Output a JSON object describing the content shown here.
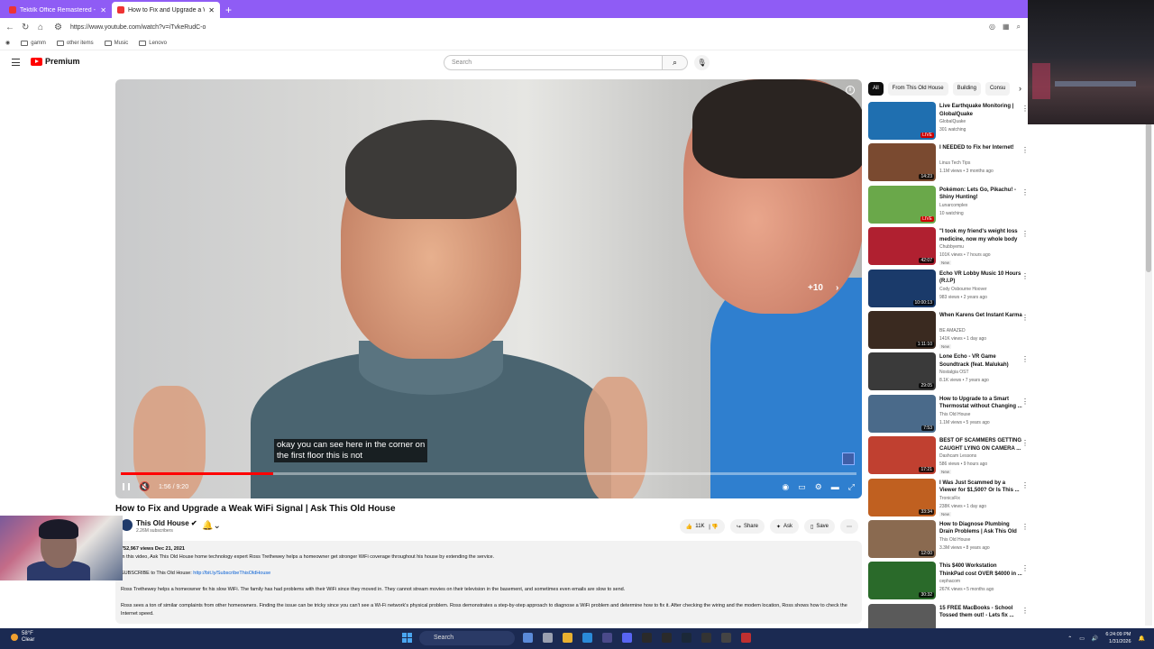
{
  "browser": {
    "tabs": [
      {
        "title": "Tektilk Office Remastered - Rob...",
        "active": false
      },
      {
        "title": "How to Fix and Upgrade a Weak W...",
        "active": true
      }
    ],
    "url": "https://www.youtube.com/watch?v=iTvkeRudC-o",
    "bookmarks": [
      "gamm",
      "other items",
      "Music",
      "Lenovo"
    ]
  },
  "yt": {
    "logo": "Premium",
    "search_placeholder": "Search"
  },
  "player": {
    "caption_line1": "okay you can see here in the corner on",
    "caption_line2": "the first floor this is not",
    "skip": "+10",
    "time": "1:56 / 9:20",
    "progress_fraction": 0.207
  },
  "video": {
    "title": "How to Fix and Upgrade a Weak WiFi Signal | Ask This Old House",
    "channel": "This Old House",
    "subs": "2.26M subscribers",
    "likes": "11K",
    "share": "Share",
    "ask": "Ask",
    "save": "Save"
  },
  "description": {
    "stats": "752,967 views  Dec 21, 2021",
    "line1": "In this video, Ask This Old House home technology expert Ross Trethewey helps a homeowner get stronger WiFi coverage throughout his house by extending the service.",
    "subscribe_label": "SUBSCRIBE to This Old House: ",
    "subscribe_link": "http://bit.ly/SubscribeThisOldHouse",
    "line2": "Ross Trethewey helps a homeowner fix his slow WiFi. The family has had problems with their WiFi since they moved in. They cannot stream movies on their television in the basement, and sometimes even emails are slow to send.",
    "line3": "Ross sees a ton of similar complaints from other homeowners. Finding the issue can be tricky since you can't see a Wi-Fi network's physical problem. Ross demonstrates a step-by-step approach to diagnose a WiFi problem and determine how to fix it. After checking the wiring and the modem location, Ross shows how to check the Internet speed."
  },
  "chips": [
    "All",
    "From This Old House",
    "Building",
    "Consu"
  ],
  "recommendations": [
    {
      "title": "Live Earthquake Monitoring | GlobalQuake",
      "channel": "GlobalQuake",
      "meta": "301 watching",
      "duration": "LIVE",
      "live": true,
      "badge": "",
      "color": "#1f6fb0"
    },
    {
      "title": "I NEEDED to Fix her Internet!",
      "channel": "Linus Tech Tips",
      "meta": "1.1M views • 3 months ago",
      "duration": "14:23",
      "live": false,
      "badge": "",
      "color": "#7a4a30"
    },
    {
      "title": "Pokémon: Lets Go, Pikachu! - Shiny Hunting!",
      "channel": "Lunarcomplex",
      "meta": "10 watching",
      "duration": "LIVE",
      "live": true,
      "badge": "",
      "color": "#6aa84a"
    },
    {
      "title": "\"I took my friend's weight loss medicine, now my whole body ...",
      "channel": "Chubbyemu",
      "meta": "101K views • 7 hours ago",
      "duration": "42:07",
      "live": false,
      "badge": "New",
      "color": "#b02030"
    },
    {
      "title": "Echo VR Lobby Music 10 Hours (R.I.P)",
      "channel": "Cody Osbourne Hoover",
      "meta": "983 views • 2 years ago",
      "duration": "10:00:13",
      "live": false,
      "badge": "",
      "color": "#1a3a6a"
    },
    {
      "title": "When Karens Get Instant Karma",
      "channel": "BE AMAZED",
      "meta": "141K views • 1 day ago",
      "duration": "1:11:10",
      "live": false,
      "badge": "New",
      "color": "#3a2a20"
    },
    {
      "title": "Lone Echo - VR Game Soundtrack (feat. Malukah)",
      "channel": "Nostalgia OST",
      "meta": "8.1K views • 7 years ago",
      "duration": "29:05",
      "live": false,
      "badge": "",
      "color": "#3a3a3a"
    },
    {
      "title": "How to Upgrade to a Smart Thermostat without Changing ...",
      "channel": "This Old House",
      "meta": "1.1M views • 5 years ago",
      "duration": "7:53",
      "live": false,
      "badge": "",
      "color": "#4a6a8a"
    },
    {
      "title": "BEST OF SCAMMERS GETTING CAUGHT LYING ON CAMERA ...",
      "channel": "Dashcam Lessons",
      "meta": "586 views • 9 hours ago",
      "duration": "17:21",
      "live": false,
      "badge": "New",
      "color": "#c04030"
    },
    {
      "title": "I Was Just Scammed by a Viewer for $1,500? Or Is This ...",
      "channel": "TronicsFix",
      "meta": "238K views • 1 day ago",
      "duration": "33:34",
      "live": false,
      "badge": "New",
      "color": "#c06020"
    },
    {
      "title": "How to Diagnose Plumbing Drain Problems | Ask This Old ...",
      "channel": "This Old House",
      "meta": "3.3M views • 8 years ago",
      "duration": "12:00",
      "live": false,
      "badge": "",
      "color": "#8a6a50"
    },
    {
      "title": "This $400 Workstation ThinkPad cost OVER $4000 in ...",
      "channel": "cephacom",
      "meta": "267K views • 5 months ago",
      "duration": "30:32",
      "live": false,
      "badge": "",
      "color": "#2a6a2a"
    },
    {
      "title": "15 FREE MacBooks - School Tossed them out! - Lets fix ...",
      "channel": "",
      "meta": "",
      "duration": "",
      "live": false,
      "badge": "",
      "color": "#5a5a5a"
    }
  ],
  "taskbar": {
    "weather_temp": "58°F",
    "weather_desc": "Clear",
    "search": "Search",
    "time": "6:24:09 PM",
    "date": "1/31/2026"
  }
}
